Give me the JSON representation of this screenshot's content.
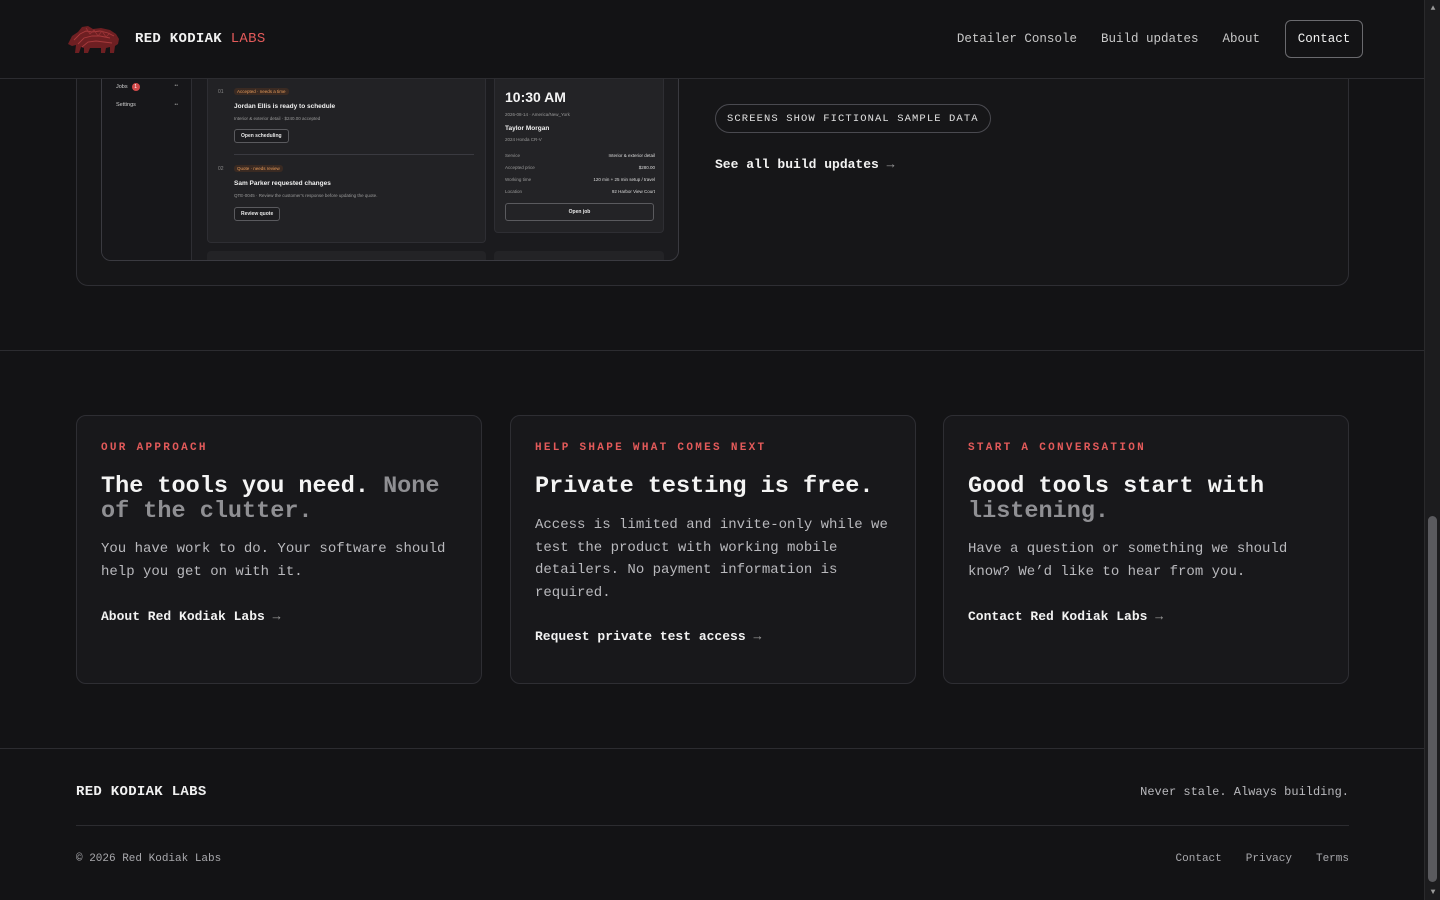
{
  "header": {
    "brand_main": "RED KODIAK",
    "brand_accent": "LABS",
    "nav": [
      "Detailer Console",
      "Build updates",
      "About"
    ],
    "contact_label": "Contact"
  },
  "hero": {
    "app_preview": {
      "sidebar": [
        {
          "label": "Jobs",
          "badge": "1",
          "count": "••"
        },
        {
          "label": "Settings",
          "count": "••"
        }
      ],
      "rows": [
        {
          "index": "01",
          "tag": "Accepted · needs a time",
          "title": "Jordan Ellis is ready to schedule",
          "sub": "Interior & exterior detail · $240.00 accepted",
          "button": "Open scheduling"
        },
        {
          "index": "02",
          "tag": "Quote · needs review",
          "title": "Sam Parker requested changes",
          "sub": "QTE-0045 · Review the customer's response before updating the quote.",
          "button": "Review quote"
        }
      ],
      "detail": {
        "time": "10:30 AM",
        "date": "2026-08-14 · America/New_York",
        "name": "Taylor Morgan",
        "vehicle": "2024 Honda CR-V",
        "fields": [
          {
            "label": "Service",
            "value": "Interior & exterior detail"
          },
          {
            "label": "Accepted price",
            "value": "$280.00"
          },
          {
            "label": "Working time",
            "value": "120 min + 25 min setup / travel"
          },
          {
            "label": "Location",
            "value": "92 Harbor View Court"
          }
        ],
        "button": "Open job"
      }
    },
    "pill": "SCREENS SHOW FICTIONAL SAMPLE DATA",
    "link": "See all build updates",
    "arrow": "→"
  },
  "cards": [
    {
      "eyebrow": "OUR APPROACH",
      "title_main": "The tools you need.",
      "title_muted": "None of the clutter.",
      "body": "You have work to do. Your software should help you get on with it.",
      "link": "About Red Kodiak Labs"
    },
    {
      "eyebrow": "HELP SHAPE WHAT COMES NEXT",
      "title_main": "Private testing is free.",
      "title_muted": "",
      "body": "Access is limited and invite-only while we test the product with working mobile detailers. No payment information is required.",
      "link": "Request private test access"
    },
    {
      "eyebrow": "START A CONVERSATION",
      "title_main": "Good tools start with",
      "title_muted": "listening.",
      "body": "Have a question or something we should know? We’d like to hear from you.",
      "link": "Contact Red Kodiak Labs"
    }
  ],
  "footer": {
    "brand": "RED KODIAK LABS",
    "tagline": "Never stale. Always building.",
    "copyright": "© 2026 Red Kodiak Labs",
    "links": [
      "Contact",
      "Privacy",
      "Terms"
    ]
  },
  "colors": {
    "background": "#131315",
    "accent": "#e35a5a",
    "card": "#18181b",
    "border": "#2e2e33"
  },
  "icons": [
    "bear-logo-icon",
    "arrow-right-icon",
    "scroll-up-icon",
    "scroll-down-icon"
  ]
}
